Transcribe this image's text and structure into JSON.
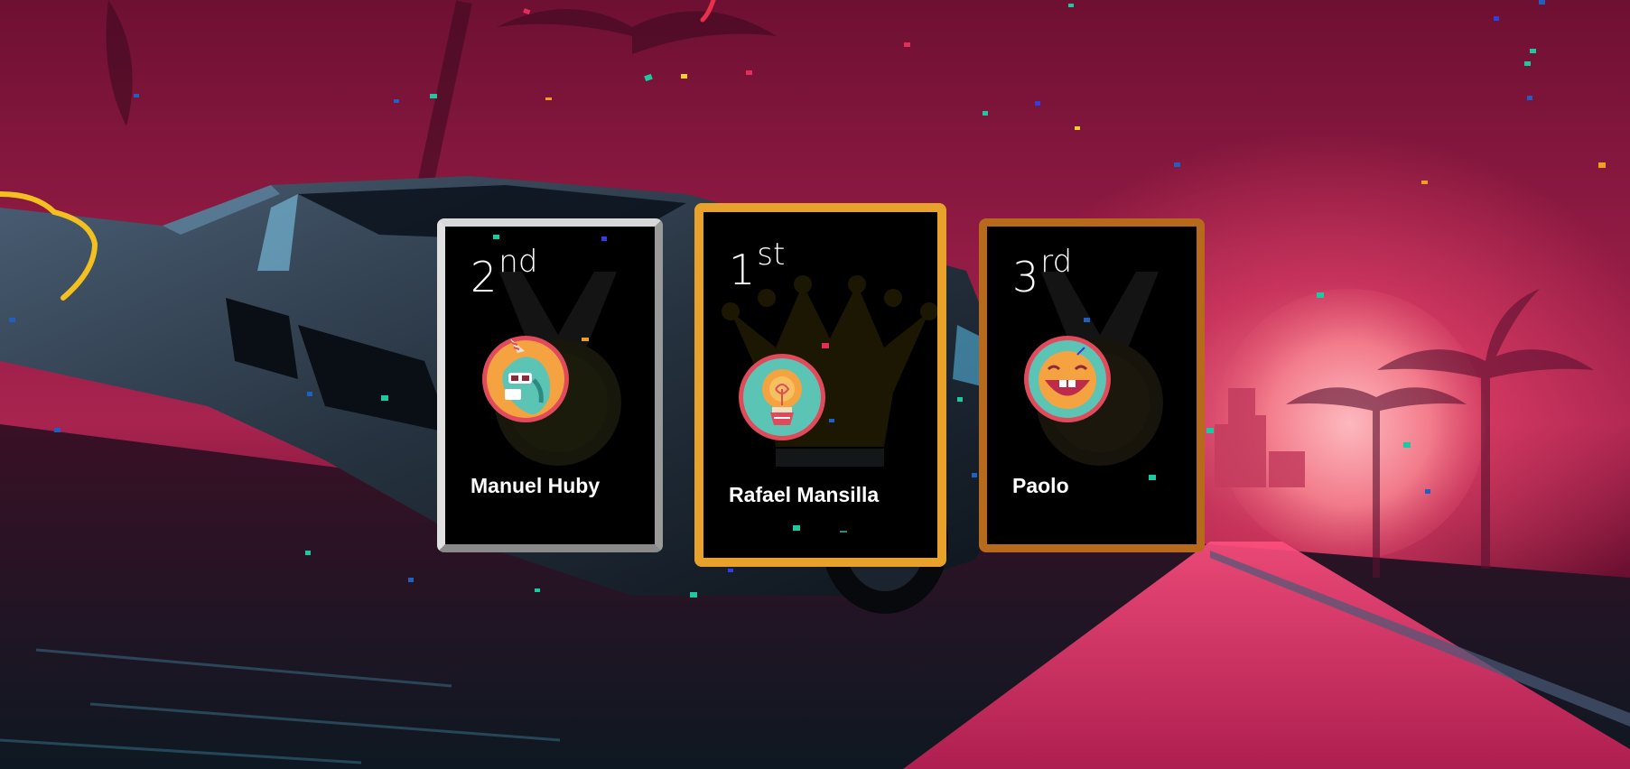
{
  "podium": {
    "first": {
      "rank": "1",
      "suffix": "st",
      "name": "Rafael Mansilla",
      "avatar_icon": "lightbulb-plant-icon",
      "frame_color": "#e8a12a"
    },
    "second": {
      "rank": "2",
      "suffix": "nd",
      "name": "Manuel Huby",
      "avatar_icon": "unicorn-icon",
      "frame_color": "#c9c9c9"
    },
    "third": {
      "rank": "3",
      "suffix": "rd",
      "name": "Paolo",
      "avatar_icon": "laughing-face-icon",
      "frame_color": "#b86a1c"
    }
  },
  "colors": {
    "background_accent": "#a8244f",
    "avatar_ring": "#e04a5a",
    "avatar_orange": "#f5a340",
    "avatar_teal": "#5cc4b4"
  }
}
